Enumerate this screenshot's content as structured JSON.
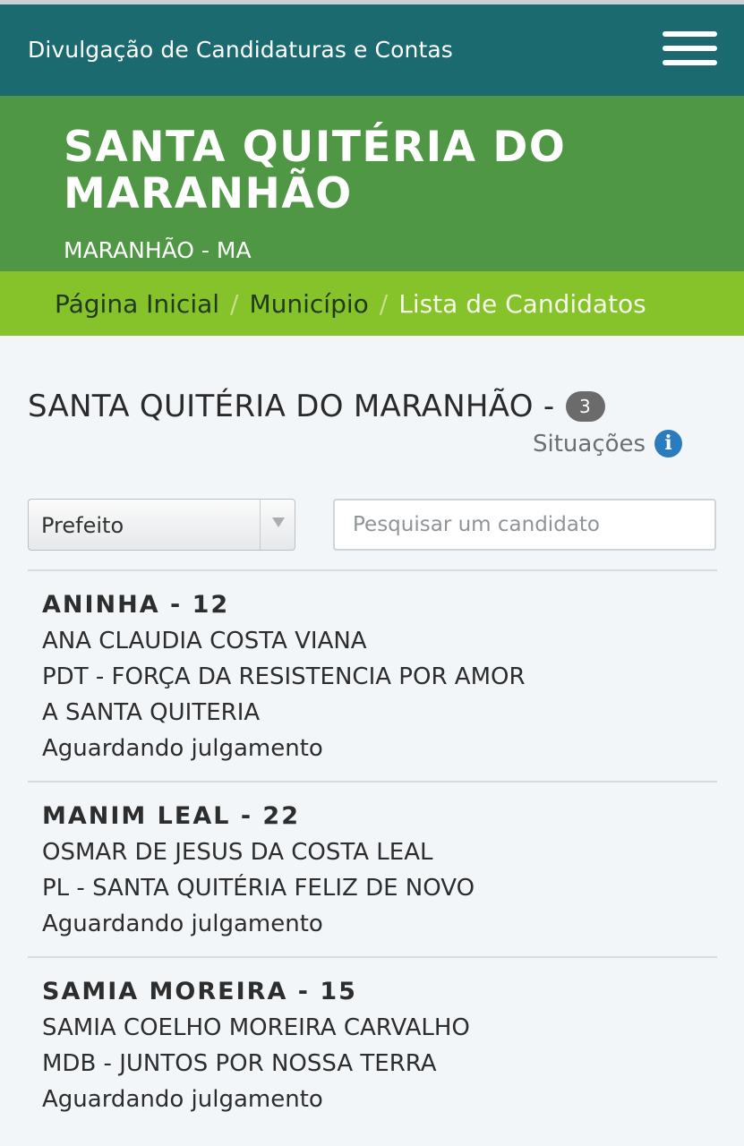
{
  "header": {
    "brand": "Divulgação de Candidaturas e Contas",
    "menu_icon": "hamburger-menu-icon"
  },
  "hero": {
    "city": "SANTA QUITÉRIA DO MARANHÃO",
    "state": "MARANHÃO - MA"
  },
  "breadcrumb": {
    "items": [
      "Página Inicial",
      "Município",
      "Lista de Candidatos"
    ],
    "separator": "/"
  },
  "list": {
    "title": "SANTA QUITÉRIA DO MARANHÃO -",
    "count": "3",
    "situacoes_label": "Situações",
    "info_icon": "info-circle-icon"
  },
  "filters": {
    "office_selected": "Prefeito",
    "search_placeholder": "Pesquisar um candidato"
  },
  "candidates": [
    {
      "ballot_name": "ANINHA - 12",
      "full_name": "ANA CLAUDIA COSTA VIANA",
      "party_line1": "PDT - FORÇA DA RESISTENCIA POR AMOR",
      "party_line2": "A SANTA QUITERIA",
      "status": "Aguardando julgamento"
    },
    {
      "ballot_name": "MANIM LEAL - 22",
      "full_name": "OSMAR DE JESUS DA COSTA LEAL",
      "party_line1": "PL - SANTA QUITÉRIA FELIZ DE NOVO",
      "status": "Aguardando julgamento"
    },
    {
      "ballot_name": "SAMIA MOREIRA - 15",
      "full_name": "SAMIA COELHO MOREIRA CARVALHO",
      "party_line1": "MDB - JUNTOS POR NOSSA TERRA",
      "status": "Aguardando julgamento"
    }
  ],
  "colors": {
    "topbar": "#1b6a70",
    "hero": "#4f9645",
    "breadcrumb": "#86c22a",
    "info": "#2b7bbf"
  }
}
